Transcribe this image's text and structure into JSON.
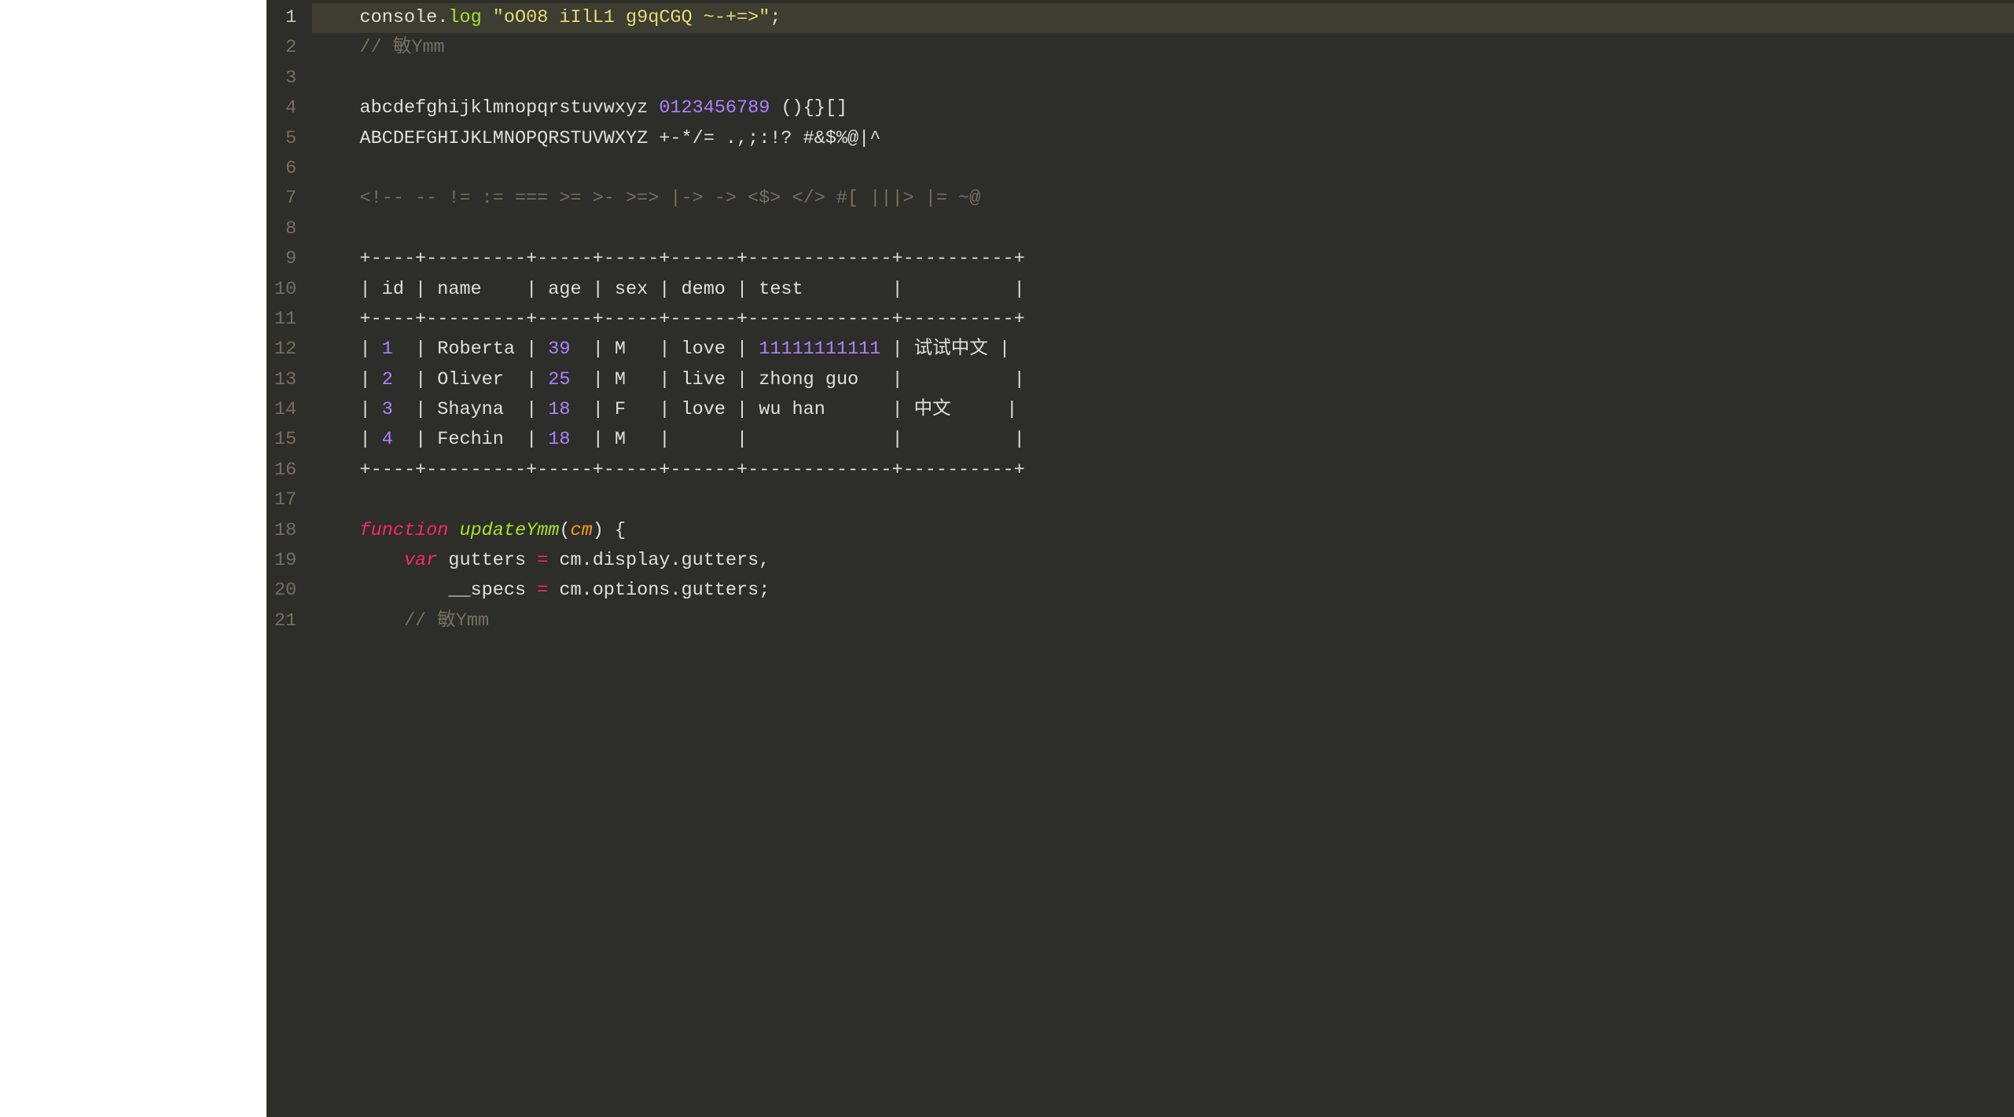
{
  "editor": {
    "activeLine": 1,
    "lines": [
      {
        "num": 1,
        "active": true,
        "tokens": [
          {
            "cls": "tok-plain",
            "t": "   "
          },
          {
            "cls": "tok-ident",
            "t": "console"
          },
          {
            "cls": "tok-punct",
            "t": "."
          },
          {
            "cls": "tok-method",
            "t": "log"
          },
          {
            "cls": "tok-plain",
            "t": " "
          },
          {
            "cls": "tok-string",
            "t": "\"oO08 iIlL1 g9qCGQ ~-+=>\""
          },
          {
            "cls": "tok-punct",
            "t": ";"
          }
        ]
      },
      {
        "num": 2,
        "tokens": [
          {
            "cls": "tok-plain",
            "t": "   "
          },
          {
            "cls": "tok-comment",
            "t": "// 敏Ymm"
          }
        ]
      },
      {
        "num": 3,
        "tokens": []
      },
      {
        "num": 4,
        "tokens": [
          {
            "cls": "tok-plain",
            "t": "   "
          },
          {
            "cls": "tok-ident",
            "t": "abcdefghijklmnopqrstuvwxyz"
          },
          {
            "cls": "tok-plain",
            "t": " "
          },
          {
            "cls": "tok-number",
            "t": "0123456789"
          },
          {
            "cls": "tok-plain",
            "t": " (){}[]"
          }
        ]
      },
      {
        "num": 5,
        "tokens": [
          {
            "cls": "tok-plain",
            "t": "   ABCDEFGHIJKLMNOPQRSTUVWXYZ +-*/= .,;:!? #&$%@|^"
          }
        ]
      },
      {
        "num": 6,
        "tokens": []
      },
      {
        "num": 7,
        "tokens": [
          {
            "cls": "tok-plain",
            "t": "   "
          },
          {
            "cls": "tok-comment",
            "t": "<!-- -- != := === >= >- >=> |-> -> <$> </> #[ |||> |= ~@"
          }
        ]
      },
      {
        "num": 8,
        "tokens": []
      },
      {
        "num": 9,
        "tokens": [
          {
            "cls": "tok-plain",
            "t": "   "
          },
          {
            "cls": "tok-plain",
            "t": "+----+---------+-----+-----+------+-------------+----------+"
          }
        ]
      },
      {
        "num": 10,
        "tokens": [
          {
            "cls": "tok-plain",
            "t": "   "
          },
          {
            "cls": "tok-plain",
            "t": "| id | name    | age | sex | demo | test        |          |"
          }
        ]
      },
      {
        "num": 11,
        "tokens": [
          {
            "cls": "tok-plain",
            "t": "   "
          },
          {
            "cls": "tok-plain",
            "t": "+----+---------+-----+-----+------+-------------+----------+"
          }
        ]
      },
      {
        "num": 12,
        "tokens": [
          {
            "cls": "tok-plain",
            "t": "   "
          },
          {
            "cls": "tok-plain",
            "t": "| "
          },
          {
            "cls": "tok-number",
            "t": "1"
          },
          {
            "cls": "tok-plain",
            "t": "  | Roberta | "
          },
          {
            "cls": "tok-number",
            "t": "39"
          },
          {
            "cls": "tok-plain",
            "t": "  | M   | love | "
          },
          {
            "cls": "tok-number",
            "t": "11111111111"
          },
          {
            "cls": "tok-plain",
            "t": " | 试试中文 |"
          }
        ]
      },
      {
        "num": 13,
        "tokens": [
          {
            "cls": "tok-plain",
            "t": "   "
          },
          {
            "cls": "tok-plain",
            "t": "| "
          },
          {
            "cls": "tok-number",
            "t": "2"
          },
          {
            "cls": "tok-plain",
            "t": "  | Oliver  | "
          },
          {
            "cls": "tok-number",
            "t": "25"
          },
          {
            "cls": "tok-plain",
            "t": "  | M   | live | zhong guo   |          |"
          }
        ]
      },
      {
        "num": 14,
        "tokens": [
          {
            "cls": "tok-plain",
            "t": "   "
          },
          {
            "cls": "tok-plain",
            "t": "| "
          },
          {
            "cls": "tok-number",
            "t": "3"
          },
          {
            "cls": "tok-plain",
            "t": "  | Shayna  | "
          },
          {
            "cls": "tok-number",
            "t": "18"
          },
          {
            "cls": "tok-plain",
            "t": "  | F   | love | wu han      | 中文     |"
          }
        ]
      },
      {
        "num": 15,
        "tokens": [
          {
            "cls": "tok-plain",
            "t": "   "
          },
          {
            "cls": "tok-plain",
            "t": "| "
          },
          {
            "cls": "tok-number",
            "t": "4"
          },
          {
            "cls": "tok-plain",
            "t": "  | Fechin  | "
          },
          {
            "cls": "tok-number",
            "t": "18"
          },
          {
            "cls": "tok-plain",
            "t": "  | M   |      |             |          |"
          }
        ]
      },
      {
        "num": 16,
        "tokens": [
          {
            "cls": "tok-plain",
            "t": "   "
          },
          {
            "cls": "tok-plain",
            "t": "+----+---------+-----+-----+------+-------------+----------+"
          }
        ]
      },
      {
        "num": 17,
        "tokens": []
      },
      {
        "num": 18,
        "tokens": [
          {
            "cls": "tok-plain",
            "t": "   "
          },
          {
            "cls": "tok-keyword",
            "t": "function"
          },
          {
            "cls": "tok-plain",
            "t": " "
          },
          {
            "cls": "tok-funcname",
            "t": "updateYmm"
          },
          {
            "cls": "tok-plain",
            "t": "("
          },
          {
            "cls": "tok-param",
            "t": "cm"
          },
          {
            "cls": "tok-plain",
            "t": ") {"
          }
        ]
      },
      {
        "num": 19,
        "tokens": [
          {
            "cls": "tok-plain",
            "t": "       "
          },
          {
            "cls": "tok-keyword-var",
            "t": "var"
          },
          {
            "cls": "tok-plain",
            "t": " gutters "
          },
          {
            "cls": "tok-keyword",
            "t": "="
          },
          {
            "cls": "tok-plain",
            "t": " cm.display.gutters,"
          }
        ]
      },
      {
        "num": 20,
        "tokens": [
          {
            "cls": "tok-plain",
            "t": "           __specs "
          },
          {
            "cls": "tok-keyword",
            "t": "="
          },
          {
            "cls": "tok-plain",
            "t": " cm.options.gutters;"
          }
        ]
      },
      {
        "num": 21,
        "tokens": [
          {
            "cls": "tok-plain",
            "t": "       "
          },
          {
            "cls": "tok-comment",
            "t": "// 敏Ymm"
          }
        ]
      }
    ]
  }
}
